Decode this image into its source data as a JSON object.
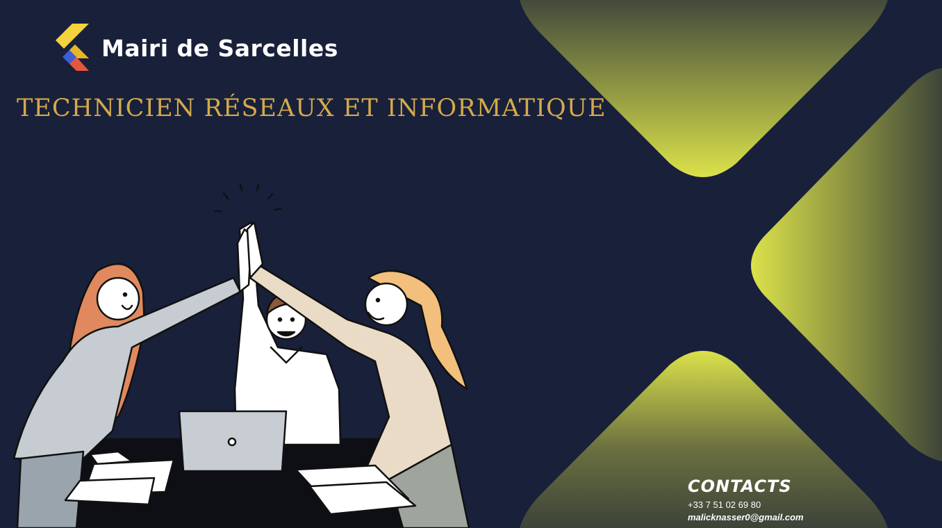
{
  "header": {
    "brand": "Mairi de Sarcelles",
    "logo": "flutter-style-logo-icon"
  },
  "main": {
    "headline": "TECHNICIEN RÉSEAUX ET INFORMATIQUE",
    "illustration": "team-high-five-illustration"
  },
  "contacts": {
    "title": "CONTACTS",
    "phone": "+33 7 51 02 69 80",
    "email": "malicknasser0@gmail.com"
  },
  "colors": {
    "background": "#18203a",
    "headline": "#d4a94c",
    "accent_yellow": "#d6e04a",
    "accent_olive": "#4a5040",
    "text": "#ffffff"
  }
}
